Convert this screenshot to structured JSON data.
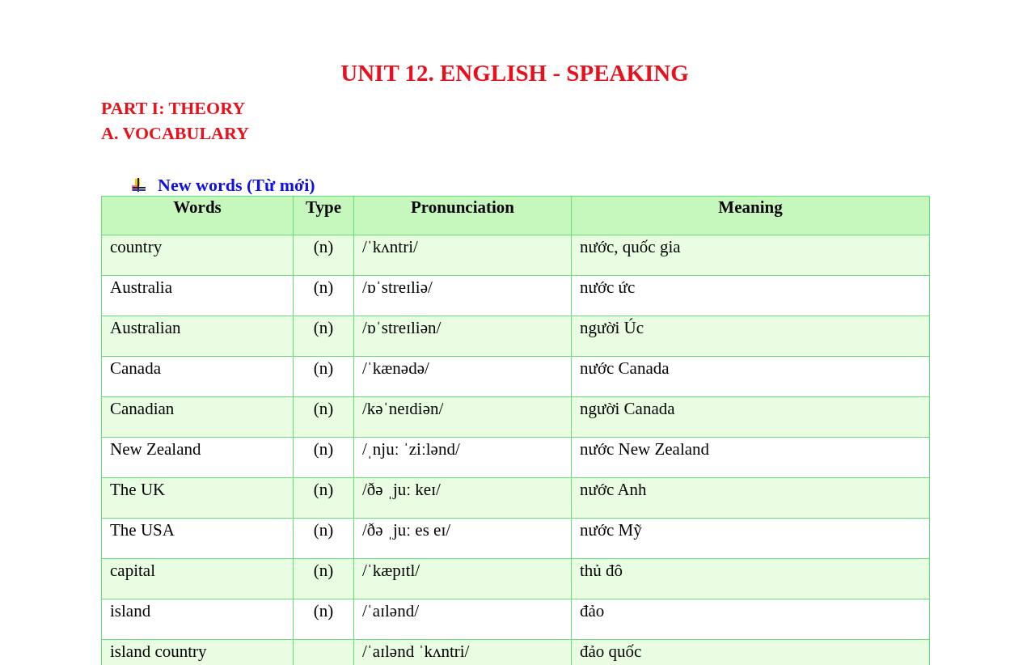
{
  "title": "UNIT 12. ENGLISH - SPEAKING",
  "part_heading": "PART I: THEORY",
  "section_heading": "A. VOCABULARY",
  "subsection": {
    "label": "New words (Từ mới)"
  },
  "table": {
    "columns": [
      "Words",
      "Type",
      "Pronunciation",
      "Meaning"
    ],
    "rows": [
      [
        "country",
        "(n)",
        "/ˈkʌntri/",
        "nước, quốc gia"
      ],
      [
        "Australia",
        "(n)",
        "/ɒˈstreɪliə/",
        "nước ức"
      ],
      [
        "Australian",
        "(n)",
        "/ɒˈstreɪliən/",
        "người Úc"
      ],
      [
        "Canada",
        "(n)",
        "/ˈkænədə/",
        "nước Canada"
      ],
      [
        "Canadian",
        "(n)",
        "/kəˈneɪdiən/",
        "người Canada"
      ],
      [
        "New Zealand",
        "(n)",
        "/ˌnjuː ˈziːlənd/",
        "nước New Zealand"
      ],
      [
        "The UK",
        "(n)",
        "/ðə ˌjuː keɪ/",
        "nước Anh"
      ],
      [
        "The USA",
        "(n)",
        "/ðə ˌjuː es eɪ/",
        "nước Mỹ"
      ],
      [
        "capital",
        "(n)",
        "/ˈkæpɪtl/",
        "thủ đô"
      ],
      [
        "island",
        "(n)",
        "/ˈaɪlənd/",
        "đảo"
      ],
      [
        "island country",
        "",
        "/ˈaɪlənd ˈkʌntri/",
        "đảo quốc"
      ]
    ]
  }
}
